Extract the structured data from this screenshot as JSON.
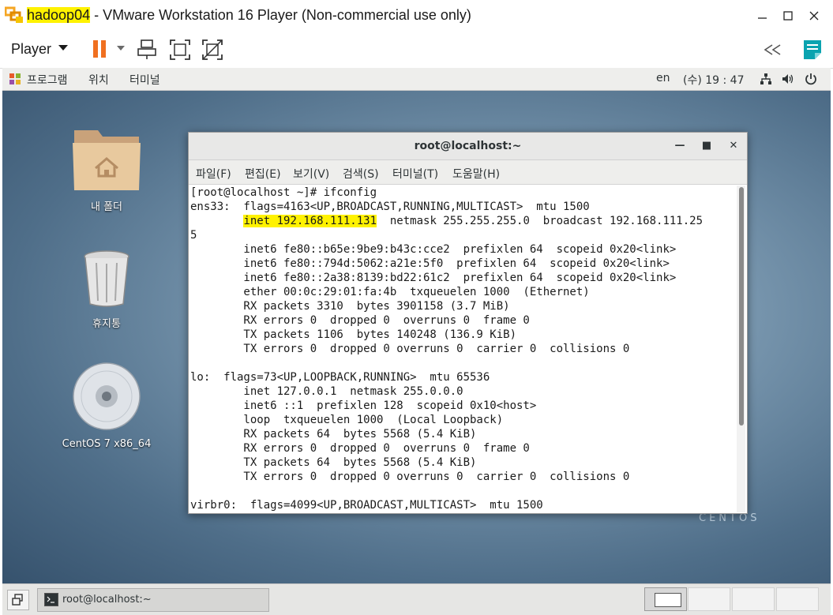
{
  "vmware": {
    "vm_name": "hadoop04",
    "title_rest": " - VMware Workstation 16 Player (Non-commercial use only)",
    "player_menu": "Player"
  },
  "gnome_panel": {
    "applications": "프로그램",
    "places": "위치",
    "terminal": "터미널",
    "input_lang": "en",
    "clock": "(수) 19 : 47"
  },
  "desktop": {
    "icons": [
      {
        "label": "내 폴더"
      },
      {
        "label": "휴지통"
      },
      {
        "label": "CentOS 7 x86_64"
      }
    ],
    "watermark": "CENTOS"
  },
  "terminal": {
    "title": "root@localhost:~",
    "menu": [
      "파일(F)",
      "편집(E)",
      "보기(V)",
      "검색(S)",
      "터미널(T)",
      "도움말(H)"
    ],
    "lines": [
      "[root@localhost ~]# ifconfig",
      "ens33:  flags=4163<UP,BROADCAST,RUNNING,MULTICAST>  mtu 1500",
      "        inet 192.168.111.131  netmask 255.255.255.0  broadcast 192.168.111.25",
      "5",
      "        inet6 fe80::b65e:9be9:b43c:cce2  prefixlen 64  scopeid 0x20<link>",
      "        inet6 fe80::794d:5062:a21e:5f0  prefixlen 64  scopeid 0x20<link>",
      "        inet6 fe80::2a38:8139:bd22:61c2  prefixlen 64  scopeid 0x20<link>",
      "        ether 00:0c:29:01:fa:4b  txqueuelen 1000  (Ethernet)",
      "        RX packets 3310  bytes 3901158 (3.7 MiB)",
      "        RX errors 0  dropped 0  overruns 0  frame 0",
      "        TX packets 1106  bytes 140248 (136.9 KiB)",
      "        TX errors 0  dropped 0 overruns 0  carrier 0  collisions 0",
      "",
      "lo:  flags=73<UP,LOOPBACK,RUNNING>  mtu 65536",
      "        inet 127.0.0.1  netmask 255.0.0.0",
      "        inet6 ::1  prefixlen 128  scopeid 0x10<host>",
      "        loop  txqueuelen 1000  (Local Loopback)",
      "        RX packets 64  bytes 5568 (5.4 KiB)",
      "        RX errors 0  dropped 0  overruns 0  frame 0",
      "        TX packets 64  bytes 5568 (5.4 KiB)",
      "        TX errors 0  dropped 0 overruns 0  carrier 0  collisions 0",
      "",
      "virbr0:  flags=4099<UP,BROADCAST,MULTICAST>  mtu 1500"
    ],
    "highlight": {
      "line": 2,
      "text": "inet 192.168.111.131"
    }
  },
  "taskbar": {
    "task_label": "root@localhost:~"
  },
  "colors": {
    "highlight": "#fff200",
    "pause_orange": "#f07020",
    "vmware_orange": "#f5a623"
  }
}
